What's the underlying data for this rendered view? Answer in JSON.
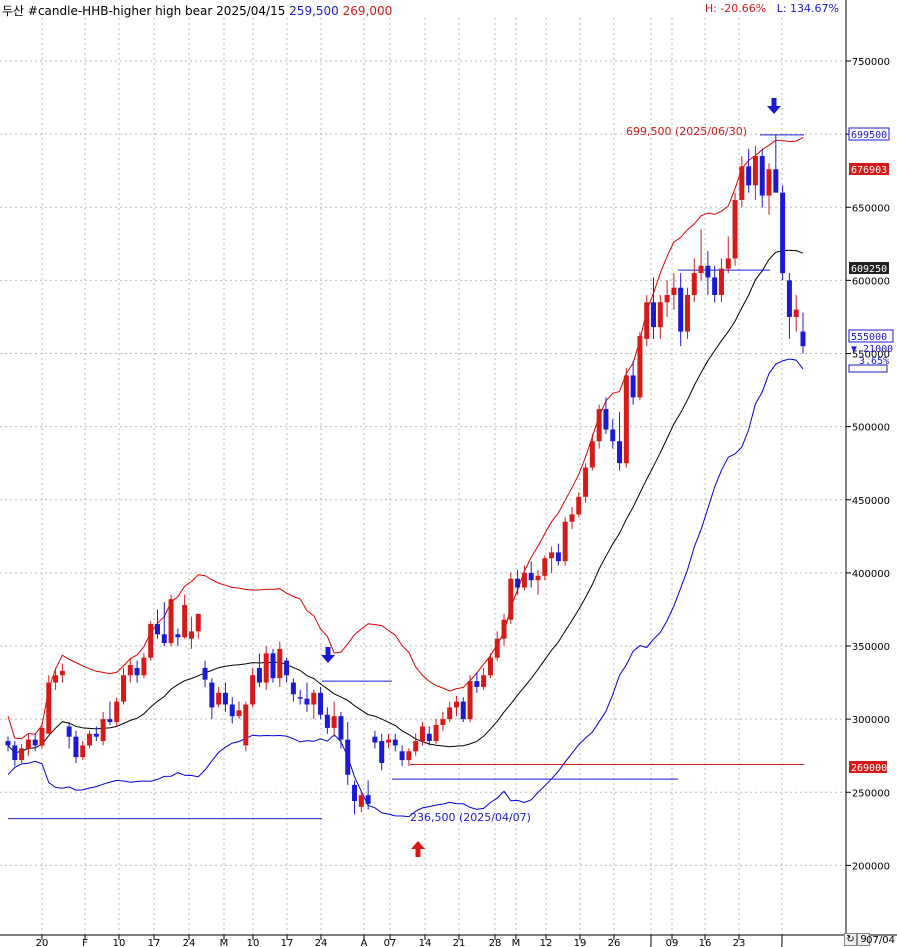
{
  "header": {
    "title": "두산 #candle-HHB-higher high bear",
    "date": "2025/04/15",
    "value_low": "259,500",
    "value_high": "269,000",
    "h_label": "H: -20.66%",
    "l_label": "L: 134.67%"
  },
  "footer": {
    "date": "07/04",
    "btn1": "↻",
    "btn2": "9"
  },
  "colors": {
    "up": "#d61a1a",
    "down": "#1a1ad6",
    "upper_band": "#e00000",
    "lower_band": "#0000e0",
    "mid_band": "#000000",
    "grid": "#bbbbbb"
  },
  "annotations": {
    "high_label": "699,500 (2025/06/30)",
    "low_label": "236,500 (2025/04/07)"
  },
  "price_badges": {
    "b1": "699500",
    "b2": "676903",
    "b3": "609250",
    "b4": "555000",
    "b5": "269000",
    "change": "▼ 21000",
    "pct": "3.65%"
  },
  "chart_data": {
    "type": "candlestick",
    "y_ticks": [
      "750000",
      "700000",
      "650000",
      "600000",
      "550000",
      "500000",
      "450000",
      "400000",
      "350000",
      "300000",
      "250000",
      "200000"
    ],
    "x_ticks": [
      "20",
      "F",
      "10",
      "17",
      "24",
      "M",
      "10",
      "17",
      "24",
      "A",
      "07",
      "14",
      "21",
      "28",
      "M",
      "12",
      "19",
      "26",
      "J",
      "09",
      "16",
      "23",
      "J"
    ],
    "ylim": [
      160000,
      790000
    ],
    "candles": [
      [
        285000,
        288000,
        278000,
        282000
      ],
      [
        282000,
        285000,
        268000,
        272000
      ],
      [
        272000,
        283000,
        270000,
        280000
      ],
      [
        280000,
        290000,
        275000,
        286000
      ],
      [
        286000,
        290000,
        278000,
        282000
      ],
      [
        282000,
        296000,
        280000,
        294000
      ],
      [
        290000,
        330000,
        290000,
        325000
      ],
      [
        325000,
        335000,
        320000,
        330000
      ],
      [
        330000,
        338000,
        325000,
        333000
      ],
      [
        295000,
        298000,
        280000,
        288000
      ],
      [
        288000,
        292000,
        270000,
        274000
      ],
      [
        274000,
        285000,
        272000,
        282000
      ],
      [
        282000,
        292000,
        280000,
        290000
      ],
      [
        290000,
        295000,
        285000,
        288000
      ],
      [
        285000,
        305000,
        282000,
        300000
      ],
      [
        300000,
        312000,
        296000,
        298000
      ],
      [
        298000,
        315000,
        295000,
        312000
      ],
      [
        312000,
        335000,
        310000,
        330000
      ],
      [
        330000,
        342000,
        325000,
        337000
      ],
      [
        335000,
        340000,
        325000,
        330000
      ],
      [
        330000,
        345000,
        328000,
        342000
      ],
      [
        342000,
        367000,
        340000,
        365000
      ],
      [
        365000,
        375000,
        355000,
        358000
      ],
      [
        358000,
        380000,
        350000,
        352000
      ],
      [
        352000,
        385000,
        350000,
        382000
      ],
      [
        358000,
        362000,
        350000,
        356000
      ],
      [
        356000,
        385000,
        355000,
        378000
      ],
      [
        355000,
        370000,
        348000,
        360000
      ],
      [
        360000,
        372000,
        355000,
        372000
      ],
      [
        335000,
        340000,
        322000,
        327000
      ],
      [
        325000,
        328000,
        300000,
        308000
      ],
      [
        310000,
        322000,
        308000,
        318000
      ],
      [
        318000,
        325000,
        305000,
        310000
      ],
      [
        310000,
        315000,
        297000,
        302000
      ],
      [
        302000,
        312000,
        300000,
        306000
      ],
      [
        282000,
        312000,
        278000,
        310000
      ],
      [
        310000,
        335000,
        308000,
        330000
      ],
      [
        335000,
        345000,
        322000,
        325000
      ],
      [
        325000,
        350000,
        320000,
        345000
      ],
      [
        345000,
        348000,
        325000,
        328000
      ],
      [
        328000,
        353000,
        322000,
        348000
      ],
      [
        340000,
        342000,
        325000,
        330000
      ],
      [
        325000,
        328000,
        312000,
        317000
      ],
      [
        315000,
        320000,
        310000,
        314000
      ],
      [
        314000,
        325000,
        305000,
        310000
      ],
      [
        310000,
        320000,
        300000,
        318000
      ],
      [
        318000,
        322000,
        300000,
        303000
      ],
      [
        303000,
        308000,
        290000,
        294000
      ],
      [
        294000,
        312000,
        288000,
        302000
      ],
      [
        302000,
        305000,
        280000,
        286000
      ],
      [
        286000,
        298000,
        255000,
        262000
      ],
      [
        255000,
        258000,
        235000,
        244000
      ],
      [
        240000,
        250000,
        236500,
        248000
      ],
      [
        248000,
        258000,
        238000,
        242000
      ],
      [
        288000,
        292000,
        280000,
        284000
      ],
      [
        285000,
        290000,
        265000,
        270000
      ],
      [
        284000,
        290000,
        280000,
        286000
      ],
      [
        286000,
        290000,
        278000,
        282000
      ],
      [
        278000,
        282000,
        268000,
        272000
      ],
      [
        272000,
        280000,
        268000,
        278000
      ],
      [
        278000,
        290000,
        275000,
        285000
      ],
      [
        285000,
        298000,
        282000,
        295000
      ],
      [
        290000,
        295000,
        282000,
        285000
      ],
      [
        285000,
        300000,
        283000,
        296000
      ],
      [
        296000,
        305000,
        292000,
        300000
      ],
      [
        300000,
        312000,
        298000,
        308000
      ],
      [
        308000,
        316000,
        302000,
        312000
      ],
      [
        312000,
        315000,
        298000,
        300000
      ],
      [
        300000,
        330000,
        298000,
        326000
      ],
      [
        326000,
        332000,
        318000,
        322000
      ],
      [
        322000,
        335000,
        320000,
        330000
      ],
      [
        330000,
        345000,
        328000,
        342000
      ],
      [
        342000,
        360000,
        340000,
        355000
      ],
      [
        355000,
        372000,
        350000,
        368000
      ],
      [
        368000,
        400000,
        365000,
        396000
      ],
      [
        396000,
        402000,
        385000,
        390000
      ],
      [
        390000,
        405000,
        388000,
        400000
      ],
      [
        400000,
        408000,
        390000,
        395000
      ],
      [
        395000,
        402000,
        385000,
        398000
      ],
      [
        398000,
        412000,
        395000,
        410000
      ],
      [
        410000,
        418000,
        400000,
        414000
      ],
      [
        414000,
        420000,
        405000,
        408000
      ],
      [
        408000,
        438000,
        405000,
        435000
      ],
      [
        435000,
        445000,
        430000,
        440000
      ],
      [
        440000,
        455000,
        438000,
        452000
      ],
      [
        452000,
        475000,
        448000,
        472000
      ],
      [
        472000,
        495000,
        470000,
        490000
      ],
      [
        490000,
        515000,
        485000,
        512000
      ],
      [
        512000,
        520000,
        495000,
        498000
      ],
      [
        498000,
        505000,
        485000,
        490000
      ],
      [
        490000,
        510000,
        470000,
        475000
      ],
      [
        475000,
        540000,
        472000,
        535000
      ],
      [
        535000,
        545000,
        515000,
        520000
      ],
      [
        520000,
        565000,
        518000,
        562000
      ],
      [
        560000,
        590000,
        555000,
        585000
      ],
      [
        585000,
        602000,
        560000,
        568000
      ],
      [
        568000,
        590000,
        560000,
        585000
      ],
      [
        585000,
        600000,
        575000,
        590000
      ],
      [
        590000,
        605000,
        580000,
        595000
      ],
      [
        595000,
        605000,
        555000,
        565000
      ],
      [
        565000,
        595000,
        560000,
        590000
      ],
      [
        590000,
        615000,
        585000,
        605000
      ],
      [
        605000,
        635000,
        600000,
        610000
      ],
      [
        610000,
        620000,
        590000,
        602000
      ],
      [
        602000,
        610000,
        585000,
        590000
      ],
      [
        590000,
        615000,
        585000,
        608000
      ],
      [
        608000,
        630000,
        605000,
        615000
      ],
      [
        615000,
        660000,
        610000,
        655000
      ],
      [
        655000,
        685000,
        650000,
        678000
      ],
      [
        678000,
        690000,
        660000,
        665000
      ],
      [
        665000,
        692000,
        655000,
        685000
      ],
      [
        685000,
        690000,
        650000,
        658000
      ],
      [
        658000,
        680000,
        645000,
        676000
      ],
      [
        676000,
        699500,
        670000,
        660000
      ],
      [
        660000,
        665000,
        600000,
        605000
      ],
      [
        600000,
        605000,
        560000,
        575000
      ],
      [
        575000,
        590000,
        565000,
        580000
      ],
      [
        565000,
        578000,
        550000,
        555000
      ]
    ]
  }
}
